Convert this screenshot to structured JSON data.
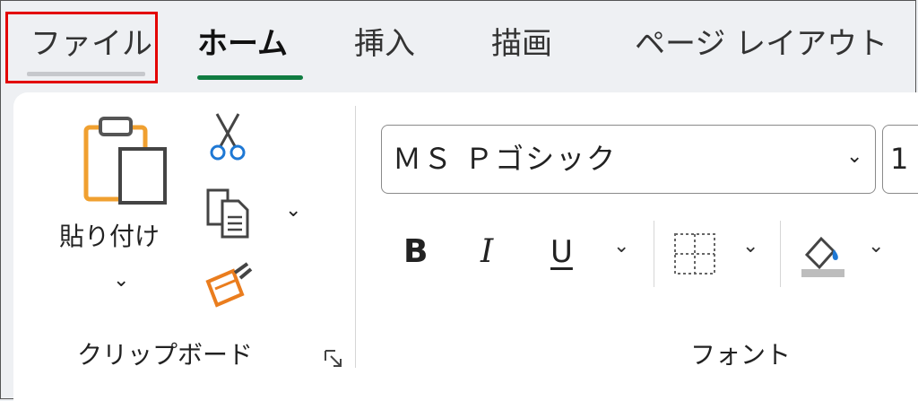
{
  "tabs": {
    "file": "ファイル",
    "home": "ホーム",
    "insert": "挿入",
    "draw": "描画",
    "page_layout": "ページ レイアウト"
  },
  "clipboard": {
    "paste_label": "貼り付け",
    "group_label": "クリップボード",
    "icons": [
      "paste-icon",
      "scissors-icon",
      "copy-icon",
      "format-painter-icon",
      "dialog-launcher-icon"
    ]
  },
  "font": {
    "font_name": "ＭＳ Ｐゴシック",
    "font_size": "1",
    "bold_label": "B",
    "italic_label": "I",
    "underline_label": "U",
    "group_label": "フォント",
    "icons": [
      "borders-icon",
      "fill-color-icon"
    ]
  },
  "colors": {
    "accent_green": "#107c41",
    "highlight_red": "#e30000",
    "clipboard_orange": "#f0a030",
    "icon_blue": "#1e78d4",
    "fill_orange": "#ea7d1e"
  }
}
